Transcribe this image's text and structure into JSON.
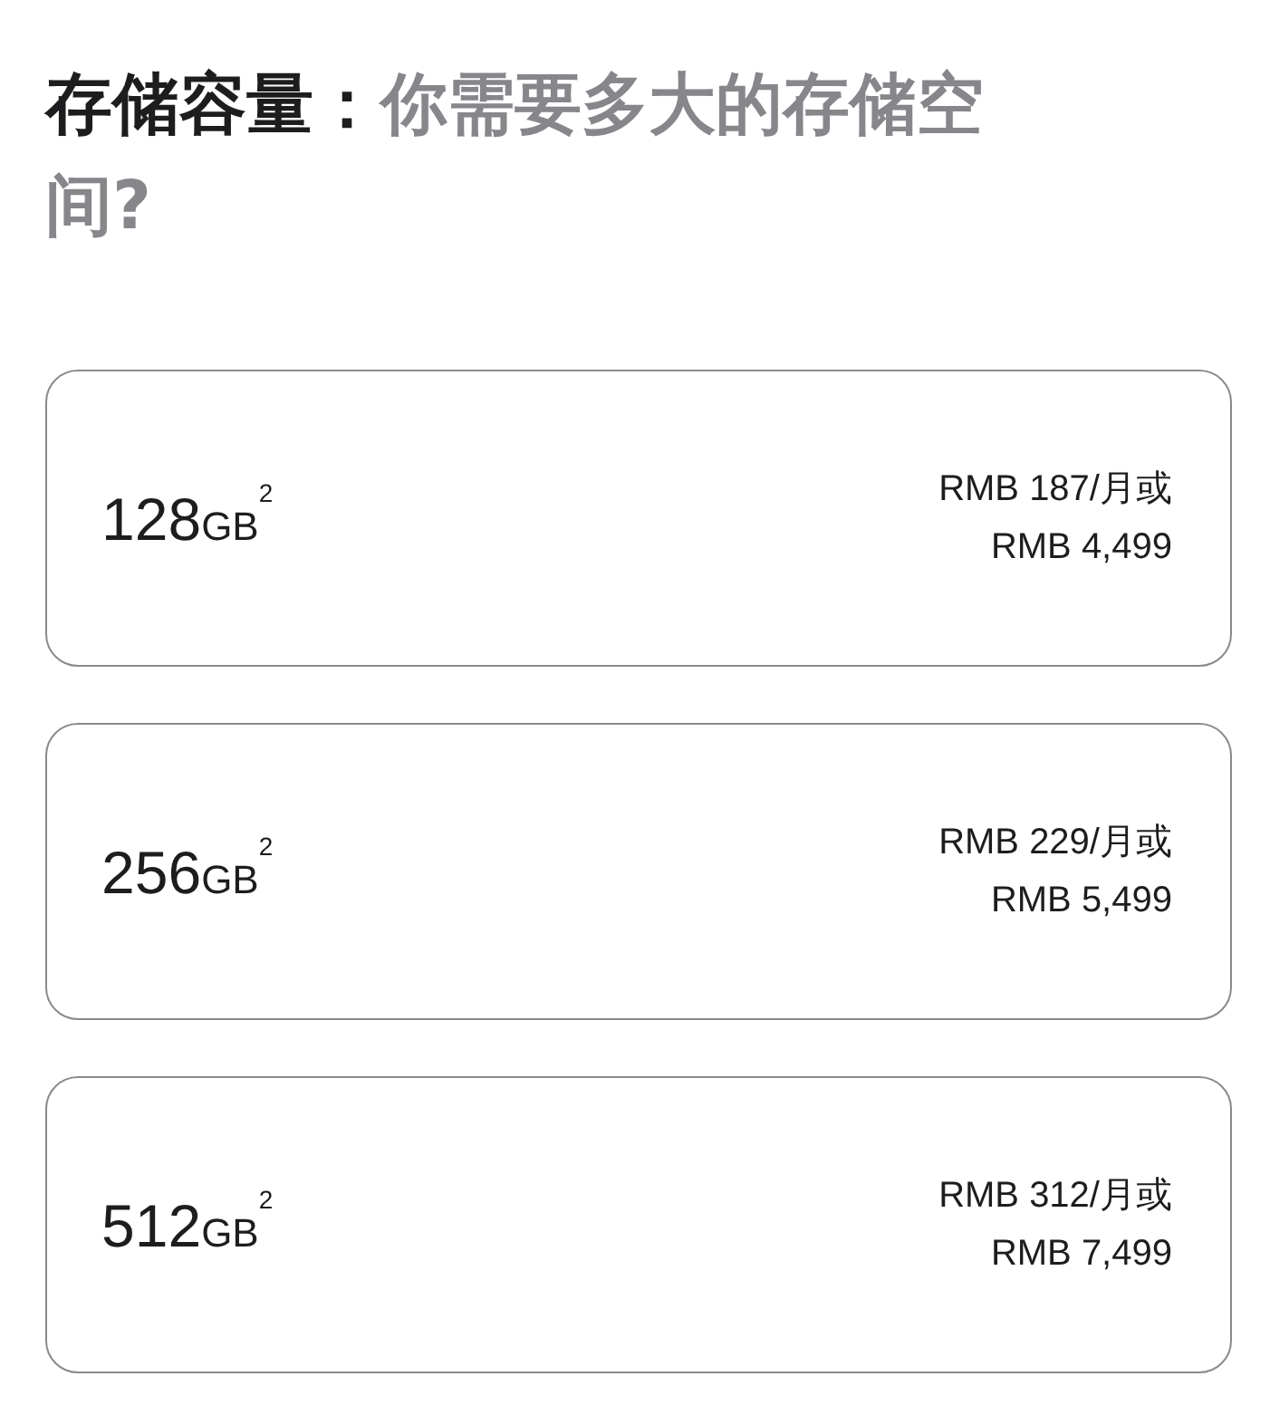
{
  "heading": {
    "lead": "存储容量：",
    "question": "你需要多大的存储空间?"
  },
  "options": [
    {
      "capacity": "128",
      "unit": "GB",
      "note": "2",
      "monthly": "RMB 187/月或",
      "price": "RMB 4,499"
    },
    {
      "capacity": "256",
      "unit": "GB",
      "note": "2",
      "monthly": "RMB 229/月或",
      "price": "RMB 5,499"
    },
    {
      "capacity": "512",
      "unit": "GB",
      "note": "2",
      "monthly": "RMB 312/月或",
      "price": "RMB 7,499"
    }
  ]
}
